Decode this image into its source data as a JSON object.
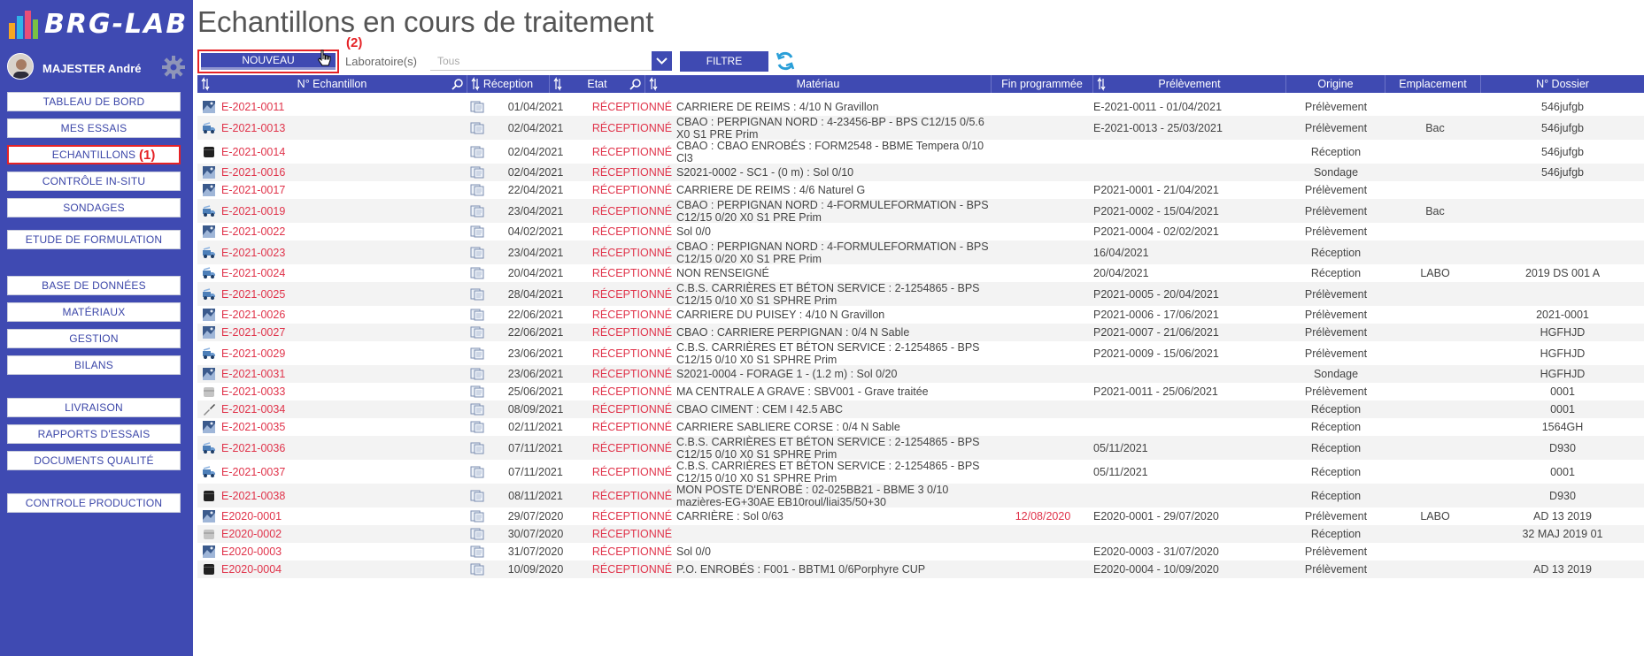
{
  "app": {
    "logo_text": "BRG-LAB"
  },
  "user": {
    "name": "MAJESTER André"
  },
  "sidebar": {
    "items": [
      {
        "label": "TABLEAU DE BORD"
      },
      {
        "label": "MES ESSAIS"
      },
      {
        "label": "ECHANTILLONS"
      },
      {
        "label": "CONTRÔLE IN-SITU"
      },
      {
        "label": "SONDAGES"
      },
      {
        "label": "ETUDE DE FORMULATION"
      },
      {
        "label": "BASE DE DONNÉES"
      },
      {
        "label": "MATÉRIAUX"
      },
      {
        "label": "GESTION"
      },
      {
        "label": "BILANS"
      },
      {
        "label": "LIVRAISON"
      },
      {
        "label": "RAPPORTS D'ESSAIS"
      },
      {
        "label": "DOCUMENTS QUALITÉ"
      },
      {
        "label": "CONTROLE PRODUCTION"
      }
    ],
    "annotation": "(1)"
  },
  "page": {
    "title": "Echantillons en cours de traitement"
  },
  "toolbar": {
    "new_label": "NOUVEAU",
    "annotation": "(2)",
    "lab_label": "Laboratoire(s)",
    "lab_value": "Tous",
    "filter_label": "FILTRE"
  },
  "table": {
    "headers": {
      "num": "N° Echantillon",
      "reception": "Réception",
      "etat": "Etat",
      "materiau": "Matériau",
      "fin": "Fin programmée",
      "prelevement": "Prélèvement",
      "origine": "Origine",
      "emplacement": "Emplacement",
      "dossier": "N° Dossier"
    },
    "rows": [
      {
        "icon": "photo-icon",
        "num": "E-2021-0011",
        "reception": "01/04/2021",
        "etat": "RÉCEPTIONNÉ",
        "mat1": "CARRIERE DE REIMS : 4/10 N Gravillon",
        "mat2": "",
        "fin": "",
        "prelevement": "E-2021-0011 - 01/04/2021",
        "origine": "Prélèvement",
        "emplacement": "",
        "dossier": "546jufgb"
      },
      {
        "icon": "truck-icon",
        "num": "E-2021-0013",
        "reception": "02/04/2021",
        "etat": "RÉCEPTIONNÉ",
        "mat1": "CBAO : PERPIGNAN NORD : 4-23456-BP - BPS C12/15 0/5.6",
        "mat2": "X0 S1 PRE Prim",
        "fin": "",
        "prelevement": "E-2021-0013 - 25/03/2021",
        "origine": "Prélèvement",
        "emplacement": "Bac",
        "dossier": "546jufgb"
      },
      {
        "icon": "drum-icon",
        "num": "E-2021-0014",
        "reception": "02/04/2021",
        "etat": "RÉCEPTIONNÉ",
        "mat1": "CBAO : CBAO ENROBÉS : FORM2548 - BBME Tempera 0/10",
        "mat2": "Cl3",
        "fin": "",
        "prelevement": "",
        "origine": "Réception",
        "emplacement": "",
        "dossier": "546jufgb"
      },
      {
        "icon": "photo-icon",
        "num": "E-2021-0016",
        "reception": "02/04/2021",
        "etat": "RÉCEPTIONNÉ",
        "mat1": "S2021-0002 - SC1 - (0 m) : Sol 0/10",
        "mat2": "",
        "fin": "",
        "prelevement": "",
        "origine": "Sondage",
        "emplacement": "",
        "dossier": "546jufgb"
      },
      {
        "icon": "photo-icon",
        "num": "E-2021-0017",
        "reception": "22/04/2021",
        "etat": "RÉCEPTIONNÉ",
        "mat1": "CARRIERE DE REIMS : 4/6 Naturel G",
        "mat2": "",
        "fin": "",
        "prelevement": "P2021-0001 - 21/04/2021",
        "origine": "Prélèvement",
        "emplacement": "",
        "dossier": ""
      },
      {
        "icon": "truck-icon",
        "num": "E-2021-0019",
        "reception": "23/04/2021",
        "etat": "RÉCEPTIONNÉ",
        "mat1": "CBAO : PERPIGNAN NORD : 4-FORMULEFORMATION - BPS",
        "mat2": "C12/15 0/20 X0 S1 PRE Prim",
        "fin": "",
        "prelevement": "P2021-0002 - 15/04/2021",
        "origine": "Prélèvement",
        "emplacement": "Bac",
        "dossier": ""
      },
      {
        "icon": "photo-icon",
        "num": "E-2021-0022",
        "reception": "04/02/2021",
        "etat": "RÉCEPTIONNÉ",
        "mat1": "Sol 0/0",
        "mat2": "",
        "fin": "",
        "prelevement": "P2021-0004 - 02/02/2021",
        "origine": "Prélèvement",
        "emplacement": "",
        "dossier": ""
      },
      {
        "icon": "truck-icon",
        "num": "E-2021-0023",
        "reception": "23/04/2021",
        "etat": "RÉCEPTIONNÉ",
        "mat1": "CBAO : PERPIGNAN NORD : 4-FORMULEFORMATION - BPS",
        "mat2": "C12/15 0/20 X0 S1 PRE Prim",
        "fin": "",
        "prelevement": "16/04/2021",
        "origine": "Réception",
        "emplacement": "",
        "dossier": ""
      },
      {
        "icon": "truck-icon",
        "num": "E-2021-0024",
        "reception": "20/04/2021",
        "etat": "RÉCEPTIONNÉ",
        "mat1": "NON RENSEIGNÉ",
        "mat2": "",
        "fin": "",
        "prelevement": "20/04/2021",
        "origine": "Réception",
        "emplacement": "LABO",
        "dossier": "2019 DS 001 A"
      },
      {
        "icon": "truck-icon",
        "num": "E-2021-0025",
        "reception": "28/04/2021",
        "etat": "RÉCEPTIONNÉ",
        "mat1": "C.B.S. CARRIÈRES ET BÉTON SERVICE : 2-1254865 - BPS",
        "mat2": "C12/15 0/10 X0 S1 SPHRE Prim",
        "fin": "",
        "prelevement": "P2021-0005 - 20/04/2021",
        "origine": "Prélèvement",
        "emplacement": "",
        "dossier": ""
      },
      {
        "icon": "photo-icon",
        "num": "E-2021-0026",
        "reception": "22/06/2021",
        "etat": "RÉCEPTIONNÉ",
        "mat1": "CARRIERE DU PUISEY : 4/10 N Gravillon",
        "mat2": "",
        "fin": "",
        "prelevement": "P2021-0006 - 17/06/2021",
        "origine": "Prélèvement",
        "emplacement": "",
        "dossier": "2021-0001"
      },
      {
        "icon": "photo-icon",
        "num": "E-2021-0027",
        "reception": "22/06/2021",
        "etat": "RÉCEPTIONNÉ",
        "mat1": "CBAO : CARRIERE PERPIGNAN : 0/4 N Sable",
        "mat2": "",
        "fin": "",
        "prelevement": "P2021-0007 - 21/06/2021",
        "origine": "Prélèvement",
        "emplacement": "",
        "dossier": "HGFHJD"
      },
      {
        "icon": "truck-icon",
        "num": "E-2021-0029",
        "reception": "23/06/2021",
        "etat": "RÉCEPTIONNÉ",
        "mat1": "C.B.S. CARRIÈRES ET BÉTON SERVICE : 2-1254865 - BPS",
        "mat2": "C12/15 0/10 X0 S1 SPHRE Prim",
        "fin": "",
        "prelevement": "P2021-0009 - 15/06/2021",
        "origine": "Prélèvement",
        "emplacement": "",
        "dossier": "HGFHJD"
      },
      {
        "icon": "photo-icon",
        "num": "E-2021-0031",
        "reception": "23/06/2021",
        "etat": "RÉCEPTIONNÉ",
        "mat1": "S2021-0004 - FORAGE 1 - (1.2 m) : Sol 0/20",
        "mat2": "",
        "fin": "",
        "prelevement": "",
        "origine": "Sondage",
        "emplacement": "",
        "dossier": "HGFHJD"
      },
      {
        "icon": "bucket-icon",
        "num": "E-2021-0033",
        "reception": "25/06/2021",
        "etat": "RÉCEPTIONNÉ",
        "mat1": "MA CENTRALE A GRAVE : SBV001 - Grave traitée",
        "mat2": "",
        "fin": "",
        "prelevement": "P2021-0011 - 25/06/2021",
        "origine": "Prélèvement",
        "emplacement": "",
        "dossier": "0001"
      },
      {
        "icon": "trowel-icon",
        "num": "E-2021-0034",
        "reception": "08/09/2021",
        "etat": "RÉCEPTIONNÉ",
        "mat1": "CBAO CIMENT : CEM I 42.5 ABC",
        "mat2": "",
        "fin": "",
        "prelevement": "",
        "origine": "Réception",
        "emplacement": "",
        "dossier": "0001"
      },
      {
        "icon": "photo-icon",
        "num": "E-2021-0035",
        "reception": "02/11/2021",
        "etat": "RÉCEPTIONNÉ",
        "mat1": "CARRIERE SABLIERE CORSE : 0/4 N Sable",
        "mat2": "",
        "fin": "",
        "prelevement": "",
        "origine": "Réception",
        "emplacement": "",
        "dossier": "1564GH"
      },
      {
        "icon": "truck-icon",
        "num": "E-2021-0036",
        "reception": "07/11/2021",
        "etat": "RÉCEPTIONNÉ",
        "mat1": "C.B.S. CARRIÈRES ET BÉTON SERVICE : 2-1254865 - BPS",
        "mat2": "C12/15 0/10 X0 S1 SPHRE Prim",
        "fin": "",
        "prelevement": "05/11/2021",
        "origine": "Réception",
        "emplacement": "",
        "dossier": "D930"
      },
      {
        "icon": "truck-icon",
        "num": "E-2021-0037",
        "reception": "07/11/2021",
        "etat": "RÉCEPTIONNÉ",
        "mat1": "C.B.S. CARRIÈRES ET BÉTON SERVICE : 2-1254865 - BPS",
        "mat2": "C12/15 0/10 X0 S1 SPHRE Prim",
        "fin": "",
        "prelevement": "05/11/2021",
        "origine": "Réception",
        "emplacement": "",
        "dossier": "0001"
      },
      {
        "icon": "drum-icon",
        "num": "E-2021-0038",
        "reception": "08/11/2021",
        "etat": "RÉCEPTIONNÉ",
        "mat1": "MON POSTE D'ENROBÉ : 02-025BB21 - BBME 3 0/10",
        "mat2": "mazières-EG+30AE EB10roul/liai35/50+30",
        "fin": "",
        "prelevement": "",
        "origine": "Réception",
        "emplacement": "",
        "dossier": "D930"
      },
      {
        "icon": "photo-icon",
        "num": "E2020-0001",
        "reception": "29/07/2020",
        "etat": "RÉCEPTIONNÉ",
        "mat1": "CARRIÈRE : Sol 0/63",
        "mat2": "",
        "fin": "12/08/2020",
        "prelevement": "E2020-0001 - 29/07/2020",
        "origine": "Prélèvement",
        "emplacement": "LABO",
        "dossier": "AD 13 2019"
      },
      {
        "icon": "bucket-icon",
        "num": "E2020-0002",
        "reception": "30/07/2020",
        "etat": "RÉCEPTIONNÉ",
        "mat1": "",
        "mat2": "",
        "fin": "",
        "prelevement": "",
        "origine": "Réception",
        "emplacement": "",
        "dossier": "32 MAJ 2019 01"
      },
      {
        "icon": "photo-icon",
        "num": "E2020-0003",
        "reception": "31/07/2020",
        "etat": "RÉCEPTIONNÉ",
        "mat1": "Sol 0/0",
        "mat2": "",
        "fin": "",
        "prelevement": "E2020-0003 - 31/07/2020",
        "origine": "Prélèvement",
        "emplacement": "",
        "dossier": ""
      },
      {
        "icon": "drum-icon",
        "num": "E2020-0004",
        "reception": "10/09/2020",
        "etat": "RÉCEPTIONNÉ",
        "mat1": "P.O. ENROBÉS : F001 - BBTM1 0/6Porphyre CUP",
        "mat2": "",
        "fin": "",
        "prelevement": "E2020-0004 - 10/09/2020",
        "origine": "Prélèvement",
        "emplacement": "",
        "dossier": "AD 13 2019"
      }
    ]
  }
}
